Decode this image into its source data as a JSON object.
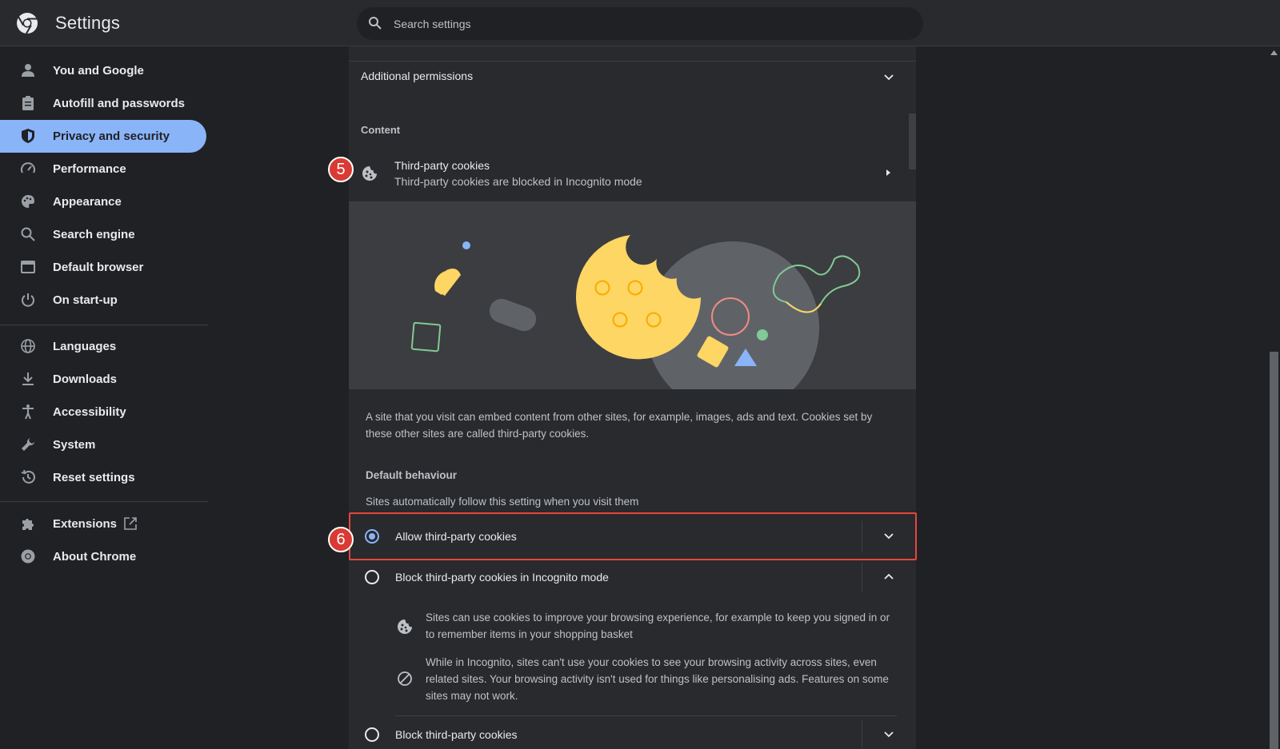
{
  "header": {
    "title": "Settings",
    "search_placeholder": "Search settings"
  },
  "sidebar": {
    "items": [
      {
        "label": "You and Google",
        "icon": "person-icon"
      },
      {
        "label": "Autofill and passwords",
        "icon": "clipboard-icon"
      },
      {
        "label": "Privacy and security",
        "icon": "shield-icon",
        "active": true
      },
      {
        "label": "Performance",
        "icon": "speedometer-icon"
      },
      {
        "label": "Appearance",
        "icon": "palette-icon"
      },
      {
        "label": "Search engine",
        "icon": "search-icon"
      },
      {
        "label": "Default browser",
        "icon": "browser-icon"
      },
      {
        "label": "On start-up",
        "icon": "power-icon"
      },
      {
        "label": "Languages",
        "icon": "globe-icon"
      },
      {
        "label": "Downloads",
        "icon": "download-icon"
      },
      {
        "label": "Accessibility",
        "icon": "accessibility-icon"
      },
      {
        "label": "System",
        "icon": "wrench-icon"
      },
      {
        "label": "Reset settings",
        "icon": "history-icon"
      },
      {
        "label": "Extensions",
        "icon": "puzzle-icon"
      },
      {
        "label": "About Chrome",
        "icon": "chrome-icon"
      }
    ]
  },
  "main": {
    "additional_permissions": "Additional permissions",
    "content_heading": "Content",
    "third_party": {
      "title": "Third-party cookies",
      "subtitle": "Third-party cookies are blocked in Incognito mode"
    },
    "description": "A site that you visit can embed content from other sites, for example, images, ads and text. Cookies set by these other sites are called third-party cookies.",
    "default_behaviour": "Default behaviour",
    "default_desc": "Sites automatically follow this setting when you visit them",
    "options": [
      {
        "label": "Allow third-party cookies",
        "checked": true
      },
      {
        "label": "Block third-party cookies in Incognito mode",
        "checked": false
      },
      {
        "label": "Block third-party cookies",
        "checked": false
      }
    ],
    "details": [
      {
        "icon": "cookie-icon",
        "text": "Sites can use cookies to improve your browsing experience, for example to keep you signed in or to remember items in your shopping basket"
      },
      {
        "icon": "block-icon",
        "text": "While in Incognito, sites can't use your cookies to see your browsing activity across sites, even related sites. Your browsing activity isn't used for things like personalising ads. Features on some sites may not work."
      }
    ]
  },
  "annotations": {
    "badge_5": "5",
    "badge_6": "6"
  },
  "colors": {
    "accent": "#8ab4f8",
    "highlight": "#e5463d",
    "badge": "#d93a34"
  }
}
